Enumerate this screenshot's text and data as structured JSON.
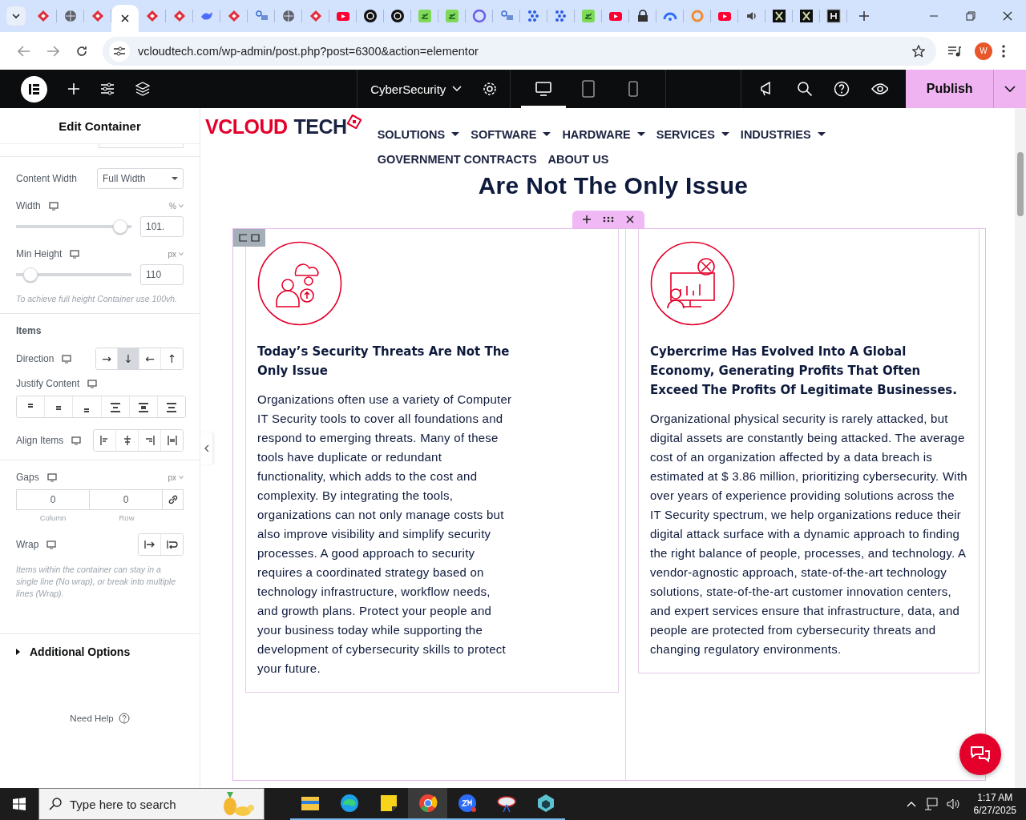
{
  "browser": {
    "tabs": [
      {
        "selected": false
      },
      {
        "selected": false
      },
      {
        "selected": false
      },
      {
        "selected": true
      },
      {
        "selected": false
      },
      {
        "selected": false
      },
      {
        "selected": false
      },
      {
        "selected": false
      },
      {
        "selected": false
      },
      {
        "selected": false
      },
      {
        "selected": false
      },
      {
        "selected": false
      },
      {
        "selected": false
      },
      {
        "selected": false
      },
      {
        "selected": false
      },
      {
        "selected": false
      },
      {
        "selected": false
      },
      {
        "selected": false
      },
      {
        "selected": false
      },
      {
        "selected": false
      },
      {
        "selected": false
      },
      {
        "selected": false
      },
      {
        "selected": false
      },
      {
        "selected": false
      },
      {
        "selected": false
      },
      {
        "selected": false
      },
      {
        "selected": false
      },
      {
        "selected": false
      },
      {
        "selected": false
      },
      {
        "selected": false
      }
    ],
    "url": "vcloudtech.com/wp-admin/post.php?post=6300&action=elementor",
    "profile_initial": "W"
  },
  "editor_bar": {
    "page_name": "CyberSecurity",
    "devices": [
      {
        "selected": true
      },
      {
        "selected": false
      },
      {
        "selected": false
      }
    ],
    "publish": "Publish"
  },
  "panel": {
    "title": "Edit Container",
    "content_width": {
      "label": "Content Width",
      "value": "Full Width"
    },
    "width": {
      "label": "Width",
      "unit": "%",
      "value": "101.",
      "level": 0.96
    },
    "min_height": {
      "label": "Min Height",
      "unit": "px",
      "value": "110",
      "level": 0.07
    },
    "min_height_hint": "To achieve full height Container use 100vh.",
    "items_heading": "Items",
    "direction": {
      "label": "Direction",
      "options": [
        {
          "symbol": "→",
          "selected": false
        },
        {
          "symbol": "↓",
          "selected": true
        },
        {
          "symbol": "←",
          "selected": false
        },
        {
          "symbol": "↑",
          "selected": false
        }
      ]
    },
    "justify_label": "Justify Content",
    "align_label": "Align Items",
    "gaps": {
      "label": "Gaps",
      "unit": "px",
      "column": "0",
      "row": "0",
      "column_label": "Column",
      "row_label": "Row"
    },
    "wrap": {
      "label": "Wrap",
      "hint": "Items within the container can stay in a single line (No wrap), or break into multiple lines (Wrap)."
    },
    "additional": {
      "label": "Additional Options",
      "expanded": false
    },
    "help": "Need Help"
  },
  "site": {
    "logo": {
      "first": "VCLOUD",
      "second": "TECH"
    },
    "nav": [
      {
        "label": "SOLUTIONS",
        "dropdown": true
      },
      {
        "label": "SOFTWARE",
        "dropdown": true
      },
      {
        "label": "HARDWARE",
        "dropdown": true
      },
      {
        "label": "SERVICES",
        "dropdown": true
      },
      {
        "label": "INDUSTRIES",
        "dropdown": true
      },
      {
        "label": "GOVERNMENT CONTRACTS",
        "dropdown": false
      },
      {
        "label": "ABOUT US",
        "dropdown": false
      }
    ],
    "heading": "Are Not The Only Issue",
    "cards": [
      {
        "title": "Today’s Security Threats Are Not The Only Issue",
        "body": "Organizations often use a variety of Computer IT Security tools to cover all foundations and respond to emerging threats. Many of these tools have duplicate or redundant functionality, which adds to the cost and complexity. By integrating the tools, organizations can not only manage costs but also improve visibility and simplify security processes. A good approach to security requires a coordinated strategy based on technology infrastructure, workflow needs, and growth plans. Protect your people and your business today while supporting the development of cybersecurity skills to protect your future."
      },
      {
        "title": "Cybercrime Has Evolved Into A Global Economy, Generating Profits That Often Exceed The Profits Of Legitimate Businesses.",
        "body": "Organizational physical security is rarely attacked, but digital assets are constantly being attacked. The average cost of an organization affected by a data breach is estimated at $ 3.86 million, prioritizing cybersecurity. With over years of experience providing solutions across the IT Security spectrum, we help organizations reduce their digital attack surface with a dynamic approach to finding the right balance of people, processes, and technology. A vendor-agnostic approach, state-of-the-art technology solutions, state-of-the-art customer innovation centers, and expert services ensure that infrastructure, data, and people are protected from cybersecurity threats and changing regulatory environments."
      }
    ]
  },
  "taskbar": {
    "search_placeholder": "Type here to search",
    "apps": [
      {
        "selected": false
      },
      {
        "selected": false
      },
      {
        "selected": false
      },
      {
        "selected": true
      },
      {
        "selected": false
      },
      {
        "selected": false
      },
      {
        "selected": false
      }
    ],
    "time": "1:17 AM",
    "date": "6/27/2025"
  }
}
